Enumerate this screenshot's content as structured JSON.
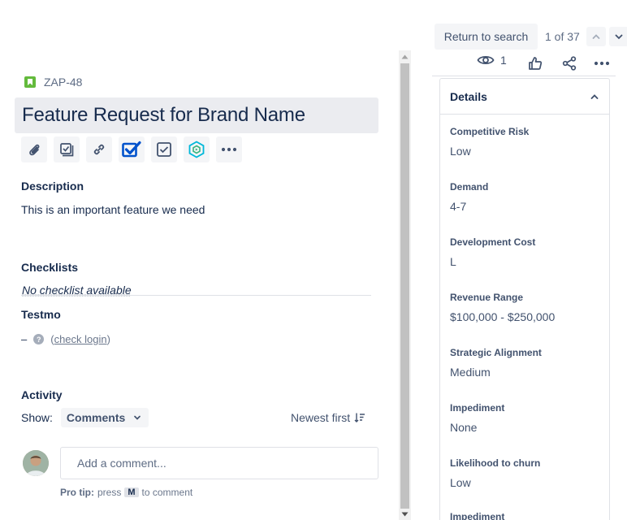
{
  "nav": {
    "return_label": "Return to search",
    "pager": "1 of 37"
  },
  "toolbar": {
    "watch_count": "1"
  },
  "issue": {
    "key": "ZAP-48",
    "title": "Feature Request for Brand Name"
  },
  "description": {
    "label": "Description",
    "text": "This is an important feature we need"
  },
  "checklists": {
    "label": "Checklists",
    "empty_text": "No checklist available"
  },
  "testmo": {
    "label": "Testmo",
    "dash": "–",
    "help_glyph": "?",
    "open_paren": "(",
    "link": "check login",
    "close_paren": ")"
  },
  "activity": {
    "label": "Activity",
    "show_label": "Show:",
    "filter_value": "Comments",
    "sort_label": "Newest first"
  },
  "comment": {
    "placeholder": "Add a comment...",
    "pro_tip_bold": "Pro tip:",
    "pro_tip_press": "press",
    "pro_tip_key": "M",
    "pro_tip_suffix": "to comment"
  },
  "details": {
    "header": "Details",
    "fields": [
      {
        "label": "Competitive Risk",
        "value": "Low"
      },
      {
        "label": "Demand",
        "value": "4-7"
      },
      {
        "label": "Development Cost",
        "value": "L"
      },
      {
        "label": "Revenue Range",
        "value": "$100,000 - $250,000"
      },
      {
        "label": "Strategic Alignment",
        "value": "Medium"
      },
      {
        "label": "Impediment",
        "value": "None"
      },
      {
        "label": "Likelihood to churn",
        "value": "Low"
      },
      {
        "label": "Impediment",
        "value": ""
      }
    ]
  },
  "colors": {
    "accent": "#0052cc",
    "story_green": "#63ba3c",
    "text": "#172b4d"
  },
  "icons": [
    "eye-icon",
    "thumbs-up-icon",
    "share-icon",
    "more-icon",
    "attachment-icon",
    "subtask-icon",
    "link-icon",
    "checklist-icon",
    "checkbox-icon",
    "app-icon",
    "chevron-up-icon",
    "chevron-down-icon"
  ]
}
